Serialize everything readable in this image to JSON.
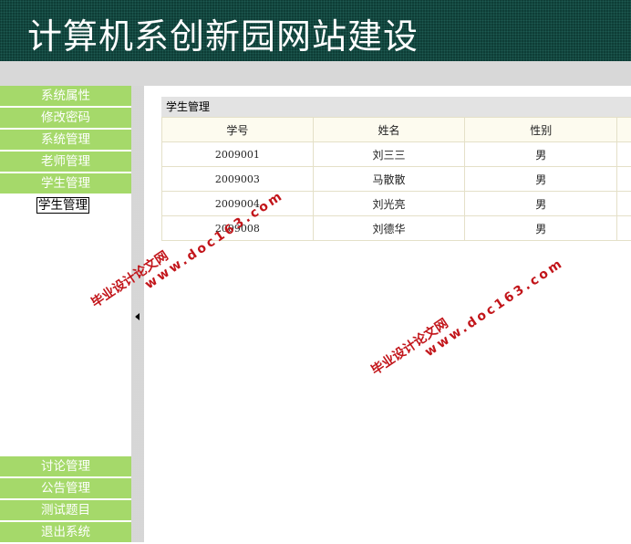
{
  "header": {
    "title": "计算机系创新园网站建设"
  },
  "nav": {
    "top_items": [
      {
        "label": "系统属性"
      },
      {
        "label": "修改密码"
      },
      {
        "label": "系统管理"
      },
      {
        "label": "老师管理"
      },
      {
        "label": "学生管理"
      }
    ],
    "active_sub": "学生管理",
    "bottom_items": [
      {
        "label": "讨论管理"
      },
      {
        "label": "公告管理"
      },
      {
        "label": "测试题目"
      },
      {
        "label": "退出系统"
      }
    ]
  },
  "panel": {
    "title": "学生管理",
    "columns": [
      "学号",
      "姓名",
      "性别"
    ],
    "rows": [
      {
        "id": "2009001",
        "name": "刘三三",
        "gender": "男"
      },
      {
        "id": "2009003",
        "name": "马散散",
        "gender": "男"
      },
      {
        "id": "2009004",
        "name": "刘光亮",
        "gender": "男"
      },
      {
        "id": "2009008",
        "name": "刘德华",
        "gender": "男"
      }
    ]
  },
  "watermark": {
    "line1": "毕业设计论文网",
    "line2": "www.doc163.com"
  }
}
